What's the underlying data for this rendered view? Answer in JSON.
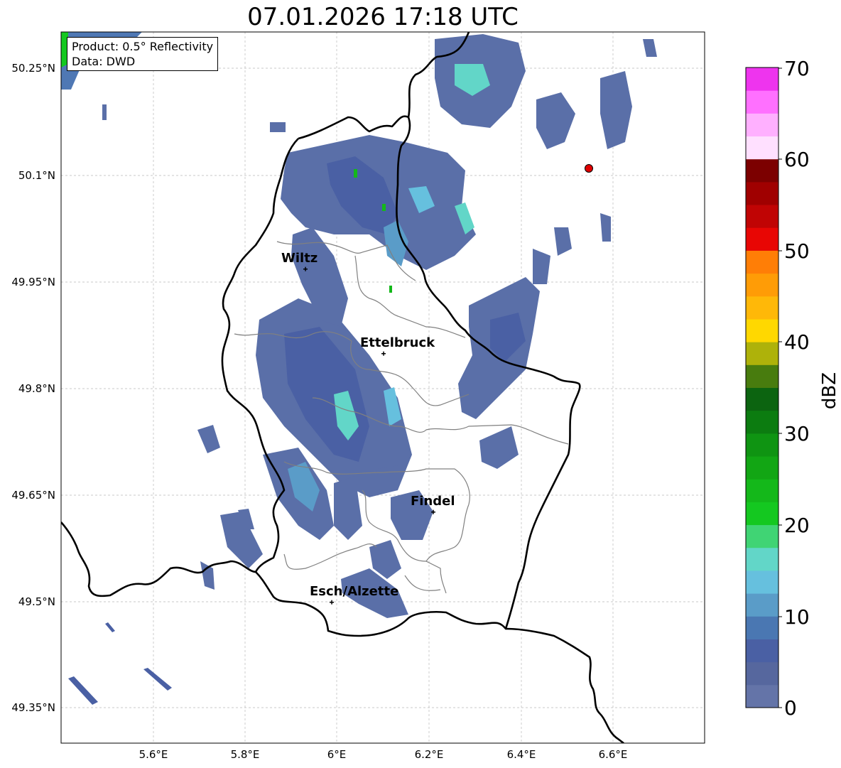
{
  "title": "07.01.2026 17:18 UTC",
  "info_box": {
    "product": "Product: 0.5° Reflectivity",
    "data": "Data: DWD"
  },
  "axes": {
    "lat_ticks": [
      "50.25°N",
      "50.1°N",
      "49.95°N",
      "49.8°N",
      "49.65°N",
      "49.5°N",
      "49.35°N"
    ],
    "lon_ticks": [
      "5.6°E",
      "5.8°E",
      "6°E",
      "6.2°E",
      "6.4°E",
      "6.6°E"
    ]
  },
  "cities": [
    {
      "name": "Wiltz"
    },
    {
      "name": "Ettelbruck"
    },
    {
      "name": "Findel"
    },
    {
      "name": "Esch/Alzette"
    }
  ],
  "colorbar": {
    "label": "dBZ",
    "ticks": [
      "0",
      "10",
      "20",
      "30",
      "40",
      "50",
      "60",
      "70"
    ],
    "colors": [
      "#6474a8",
      "#56679e",
      "#4a60a4",
      "#4a77b2",
      "#5a9cc8",
      "#66c0de",
      "#62d6c8",
      "#40d474",
      "#14c820",
      "#14b81a",
      "#12a614",
      "#0f9412",
      "#0c7c10",
      "#0c6410",
      "#487c0e",
      "#aeb20a",
      "#ffd800",
      "#ffb808",
      "#ff9c06",
      "#ff7e06",
      "#e80604",
      "#c00404",
      "#a00000",
      "#7c0000",
      "#ffe0ff",
      "#ffb0ff",
      "#ff70ff",
      "#ee34ee"
    ]
  },
  "colors": {
    "border_national": "#000000",
    "border_cantonal": "#808080",
    "radar_site": "#e00000"
  }
}
